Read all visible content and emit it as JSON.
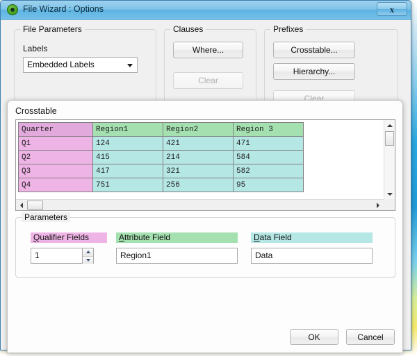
{
  "window": {
    "title": "File Wizard : Options",
    "app_icon": "qlikview-logo-icon",
    "close_label": "x"
  },
  "file_parameters": {
    "legend": "File Parameters",
    "labels_caption": "Labels",
    "labels_value": "Embedded Labels"
  },
  "clauses": {
    "legend": "Clauses",
    "where_button": "Where...",
    "clear_button": "Clear"
  },
  "prefixes": {
    "legend": "Prefixes",
    "crosstable_button": "Crosstable...",
    "hierarchy_button": "Hierarchy...",
    "clear_button": "Clear"
  },
  "crosstable_dialog": {
    "title": "Crosstable",
    "preview_table": {
      "headers": [
        "Quarter",
        "Region1",
        "Region2",
        "Region 3"
      ],
      "rows": [
        [
          "Q1",
          "124",
          "421",
          "471"
        ],
        [
          "Q2",
          "415",
          "214",
          "584"
        ],
        [
          "Q3",
          "417",
          "321",
          "582"
        ],
        [
          "Q4",
          "751",
          "256",
          "95"
        ]
      ]
    },
    "parameters": {
      "legend": "Parameters",
      "qualifier_fields_caption": "Qualifier Fields",
      "qualifier_fields_accel": "Q",
      "qualifier_fields_value": "1",
      "attribute_field_caption": "Attribute Field",
      "attribute_field_accel": "A",
      "attribute_field_value": "Region1",
      "data_field_caption": "Data Field",
      "data_field_accel": "D",
      "data_field_value": "Data"
    },
    "ok_button": "OK",
    "cancel_button": "Cancel"
  },
  "colors": {
    "title_bar": "#7fc4e8",
    "qualifier_header": "#e2a9dd",
    "qualifier_cell": "#efb4e6",
    "attribute_header": "#a5e0b0",
    "data_cell": "#b5e7e5",
    "dialog_background": "#fdfdfd"
  }
}
